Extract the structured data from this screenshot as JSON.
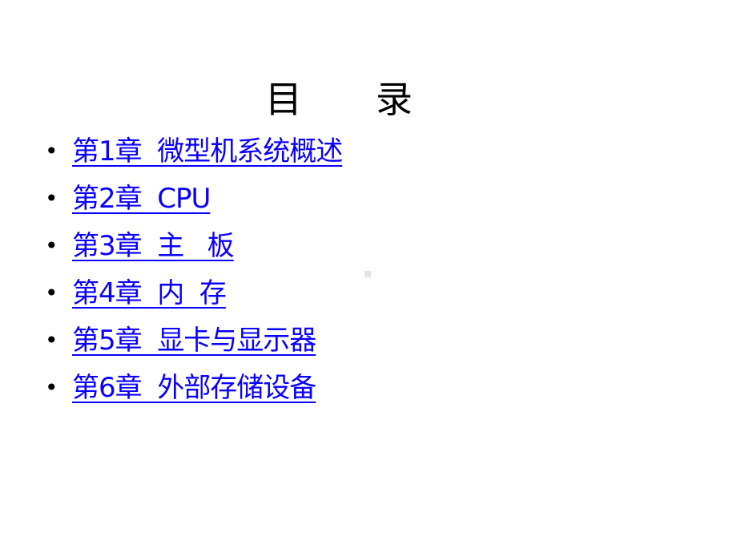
{
  "title": {
    "char1": "目",
    "char2": "录"
  },
  "toc": [
    {
      "label": "第1章  微型机系统概述"
    },
    {
      "label": "第2章  CPU"
    },
    {
      "label": "第3章  主   板"
    },
    {
      "label": "第4章  内  存"
    },
    {
      "label": "第5章  显卡与显示器"
    },
    {
      "label": "第6章  外部存储设备"
    }
  ],
  "colors": {
    "link": "#0a00ff",
    "text": "#000000",
    "background": "#ffffff"
  }
}
